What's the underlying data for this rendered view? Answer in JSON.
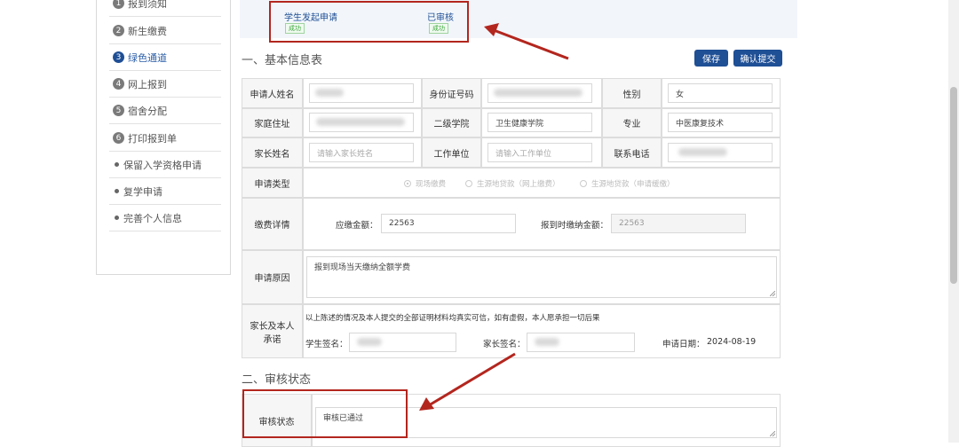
{
  "sidebar": {
    "items": [
      {
        "num": "1",
        "label": "报到须知"
      },
      {
        "num": "2",
        "label": "新生缴费"
      },
      {
        "num": "3",
        "label": "绿色通道"
      },
      {
        "num": "4",
        "label": "网上报到"
      },
      {
        "num": "5",
        "label": "宿舍分配"
      },
      {
        "num": "6",
        "label": "打印报到单"
      },
      {
        "label": "保留入学资格申请"
      },
      {
        "label": "复学申请"
      },
      {
        "label": "完善个人信息"
      }
    ]
  },
  "progress": {
    "step1": {
      "label": "学生发起申请",
      "status": "成功"
    },
    "step2": {
      "label": "已审核",
      "status": "成功"
    }
  },
  "section1": {
    "title": "一、基本信息表",
    "save_label": "保存",
    "submit_label": "确认提交"
  },
  "form": {
    "applicant_name_label": "申请人姓名",
    "id_number_label": "身份证号码",
    "gender_label": "性别",
    "gender_value": "女",
    "address_label": "家庭住址",
    "college_label": "二级学院",
    "college_value": "卫生健康学院",
    "major_label": "专业",
    "major_value": "中医康复技术",
    "parent_name_label": "家长姓名",
    "parent_name_placeholder": "请输入家长姓名",
    "work_unit_label": "工作单位",
    "work_unit_placeholder": "请输入工作单位",
    "phone_label": "联系电话",
    "apply_type_label": "申请类型",
    "apply_type_options": [
      "现场缴费",
      "生源地贷款（网上缴费）",
      "生源地贷款（申请缓缴）"
    ],
    "fee_detail_label": "缴费详情",
    "due_amount_label": "应缴金额：",
    "due_amount_value": "22563",
    "pay_at_report_label": "报到时缴纳金额：",
    "pay_at_report_value": "22563",
    "reason_label": "申请原因",
    "reason_value": "报到现场当天缴纳全额学费",
    "pledge_label": "家长及本人承诺",
    "pledge_text": "以上陈述的情况及本人提交的全部证明材料均真实可信，如有虚假，本人愿承担一切后果",
    "student_sign_label": "学生签名：",
    "parent_sign_label": "家长签名：",
    "apply_date_label": "申请日期：",
    "apply_date_value": "2024-08-19"
  },
  "section2": {
    "title": "二、审核状态",
    "review_status_label": "审核状态",
    "review_status_value": "审核已通过"
  },
  "colors": {
    "primary": "#1f4f95",
    "annotation_red": "#b3261e",
    "success_green": "#3ca53c"
  }
}
